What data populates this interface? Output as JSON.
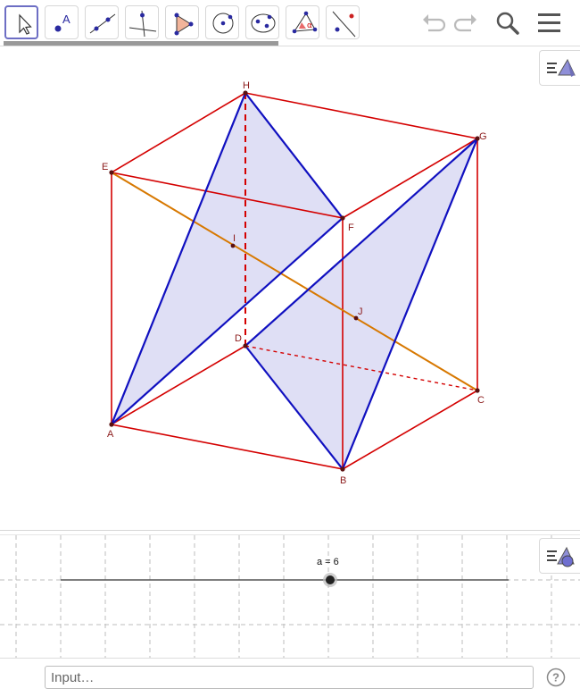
{
  "toolbar": {
    "tools": [
      {
        "name": "move-tool",
        "icon": "arrow-icon",
        "selected": true
      },
      {
        "name": "point-tool",
        "icon": "point-icon",
        "label": "A"
      },
      {
        "name": "line-tool",
        "icon": "line-icon"
      },
      {
        "name": "perpendicular-line-tool",
        "icon": "perpendicular-icon"
      },
      {
        "name": "polygon-tool",
        "icon": "polygon-icon"
      },
      {
        "name": "circle-tool",
        "icon": "circle-icon"
      },
      {
        "name": "conic-tool",
        "icon": "ellipse-icon"
      },
      {
        "name": "angle-tool",
        "icon": "angle-icon",
        "label": "α"
      },
      {
        "name": "reflect-tool",
        "icon": "reflect-icon"
      }
    ],
    "undo_icon": "undo-icon",
    "redo_icon": "redo-icon",
    "search_icon": "search-icon",
    "menu_icon": "menu-icon",
    "progress_fraction": 0.48
  },
  "colors": {
    "cube_edge": "#d40000",
    "blue_edge": "#1010c0",
    "diagonal": "#d77800",
    "plane_fill": "#c9c9ee",
    "point": "#5a1010",
    "label": "#8b1a1a"
  },
  "points": {
    "A": {
      "label": "A"
    },
    "B": {
      "label": "B"
    },
    "C": {
      "label": "C"
    },
    "D": {
      "label": "D"
    },
    "E": {
      "label": "E"
    },
    "F": {
      "label": "F"
    },
    "G": {
      "label": "G"
    },
    "H": {
      "label": "H"
    },
    "I": {
      "label": "I"
    },
    "J": {
      "label": "J"
    }
  },
  "graphics": {
    "style_bar_icon": "graphics-style-icon",
    "style_bar2_icon": "graphics2-style-icon"
  },
  "slider": {
    "label": "a = 6",
    "value": 6
  },
  "input_bar": {
    "placeholder": "Input…",
    "help_icon": "help-icon"
  }
}
